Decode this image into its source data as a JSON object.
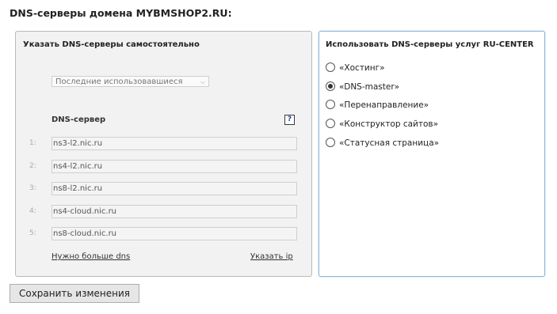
{
  "page_title": "DNS-серверы домена MYBMSHOP2.RU:",
  "manual_panel": {
    "title": "Указать DNS-серверы самостоятельно",
    "recent_select": {
      "selected": "Последние использовавшиеся"
    },
    "dns_label": "DNS-сервер",
    "help_glyph": "?",
    "servers": [
      {
        "num": "1:",
        "value": "ns3-l2.nic.ru"
      },
      {
        "num": "2:",
        "value": "ns4-l2.nic.ru"
      },
      {
        "num": "3:",
        "value": "ns8-l2.nic.ru"
      },
      {
        "num": "4:",
        "value": "ns4-cloud.nic.ru"
      },
      {
        "num": "5:",
        "value": "ns8-cloud.nic.ru"
      }
    ],
    "more_dns_link": "Нужно больше dns",
    "specify_ip_link": "Указать ip"
  },
  "service_panel": {
    "title": "Использовать DNS-серверы услуг RU-CENTER",
    "options": [
      {
        "label": "«Хостинг»",
        "checked": false
      },
      {
        "label": "«DNS-master»",
        "checked": true
      },
      {
        "label": "«Перенаправление»",
        "checked": false
      },
      {
        "label": "«Конструктор сайтов»",
        "checked": false
      },
      {
        "label": "«Статусная страница»",
        "checked": false
      }
    ]
  },
  "save_button": "Сохранить изменения"
}
